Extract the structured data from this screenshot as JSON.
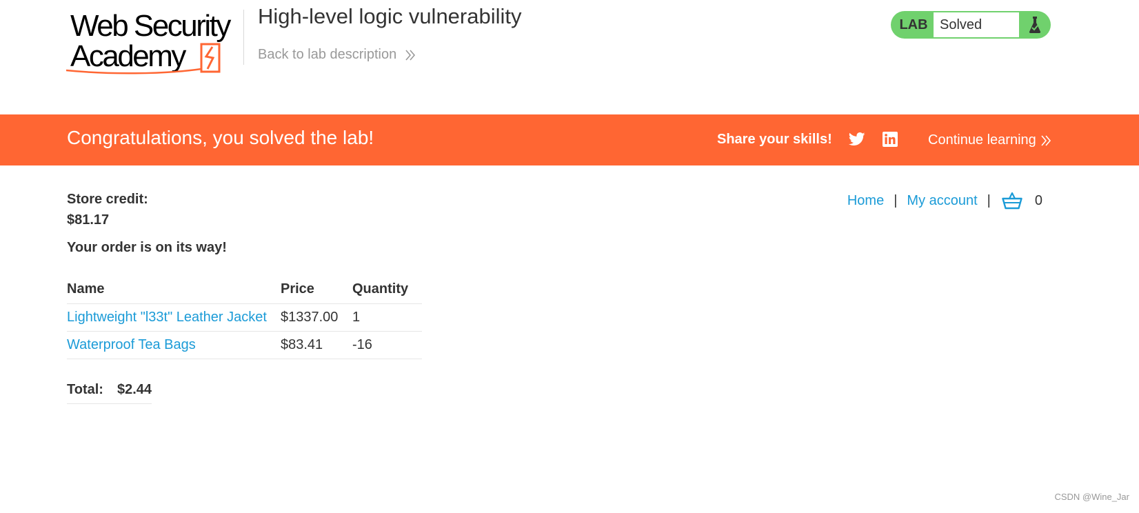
{
  "header": {
    "logo_line1": "Web Security",
    "logo_line2": "Academy",
    "lab_title": "High-level logic vulnerability",
    "back_link": "Back to lab description",
    "lab_status": {
      "tag": "LAB",
      "state": "Solved",
      "color": "#70d16d",
      "icon": "flask-icon"
    }
  },
  "banner": {
    "message": "Congratulations, you solved the lab!",
    "share_label": "Share your skills!",
    "share_icons": [
      "twitter-icon",
      "linkedin-icon"
    ],
    "continue_link": "Continue learning",
    "color": "#ff6633"
  },
  "nav": {
    "home": "Home",
    "separator": "|",
    "account": "My account",
    "cart_icon": "basket-icon",
    "cart_count": "0"
  },
  "store_credit": {
    "label": "Store credit:",
    "value": "$81.17"
  },
  "order_message": "Your order is on its way!",
  "order_table": {
    "headers": {
      "name": "Name",
      "price": "Price",
      "quantity": "Quantity"
    },
    "rows": [
      {
        "name": "Lightweight \"l33t\" Leather Jacket",
        "price": "$1337.00",
        "quantity": "1"
      },
      {
        "name": "Waterproof Tea Bags",
        "price": "$83.41",
        "quantity": "-16"
      }
    ]
  },
  "total": {
    "label": "Total:",
    "value": "$2.44"
  },
  "watermark": "CSDN @Wine_Jar",
  "colors": {
    "accent_orange": "#ff6633",
    "link_blue": "#1b9bd7",
    "solved_green": "#70d16d"
  }
}
